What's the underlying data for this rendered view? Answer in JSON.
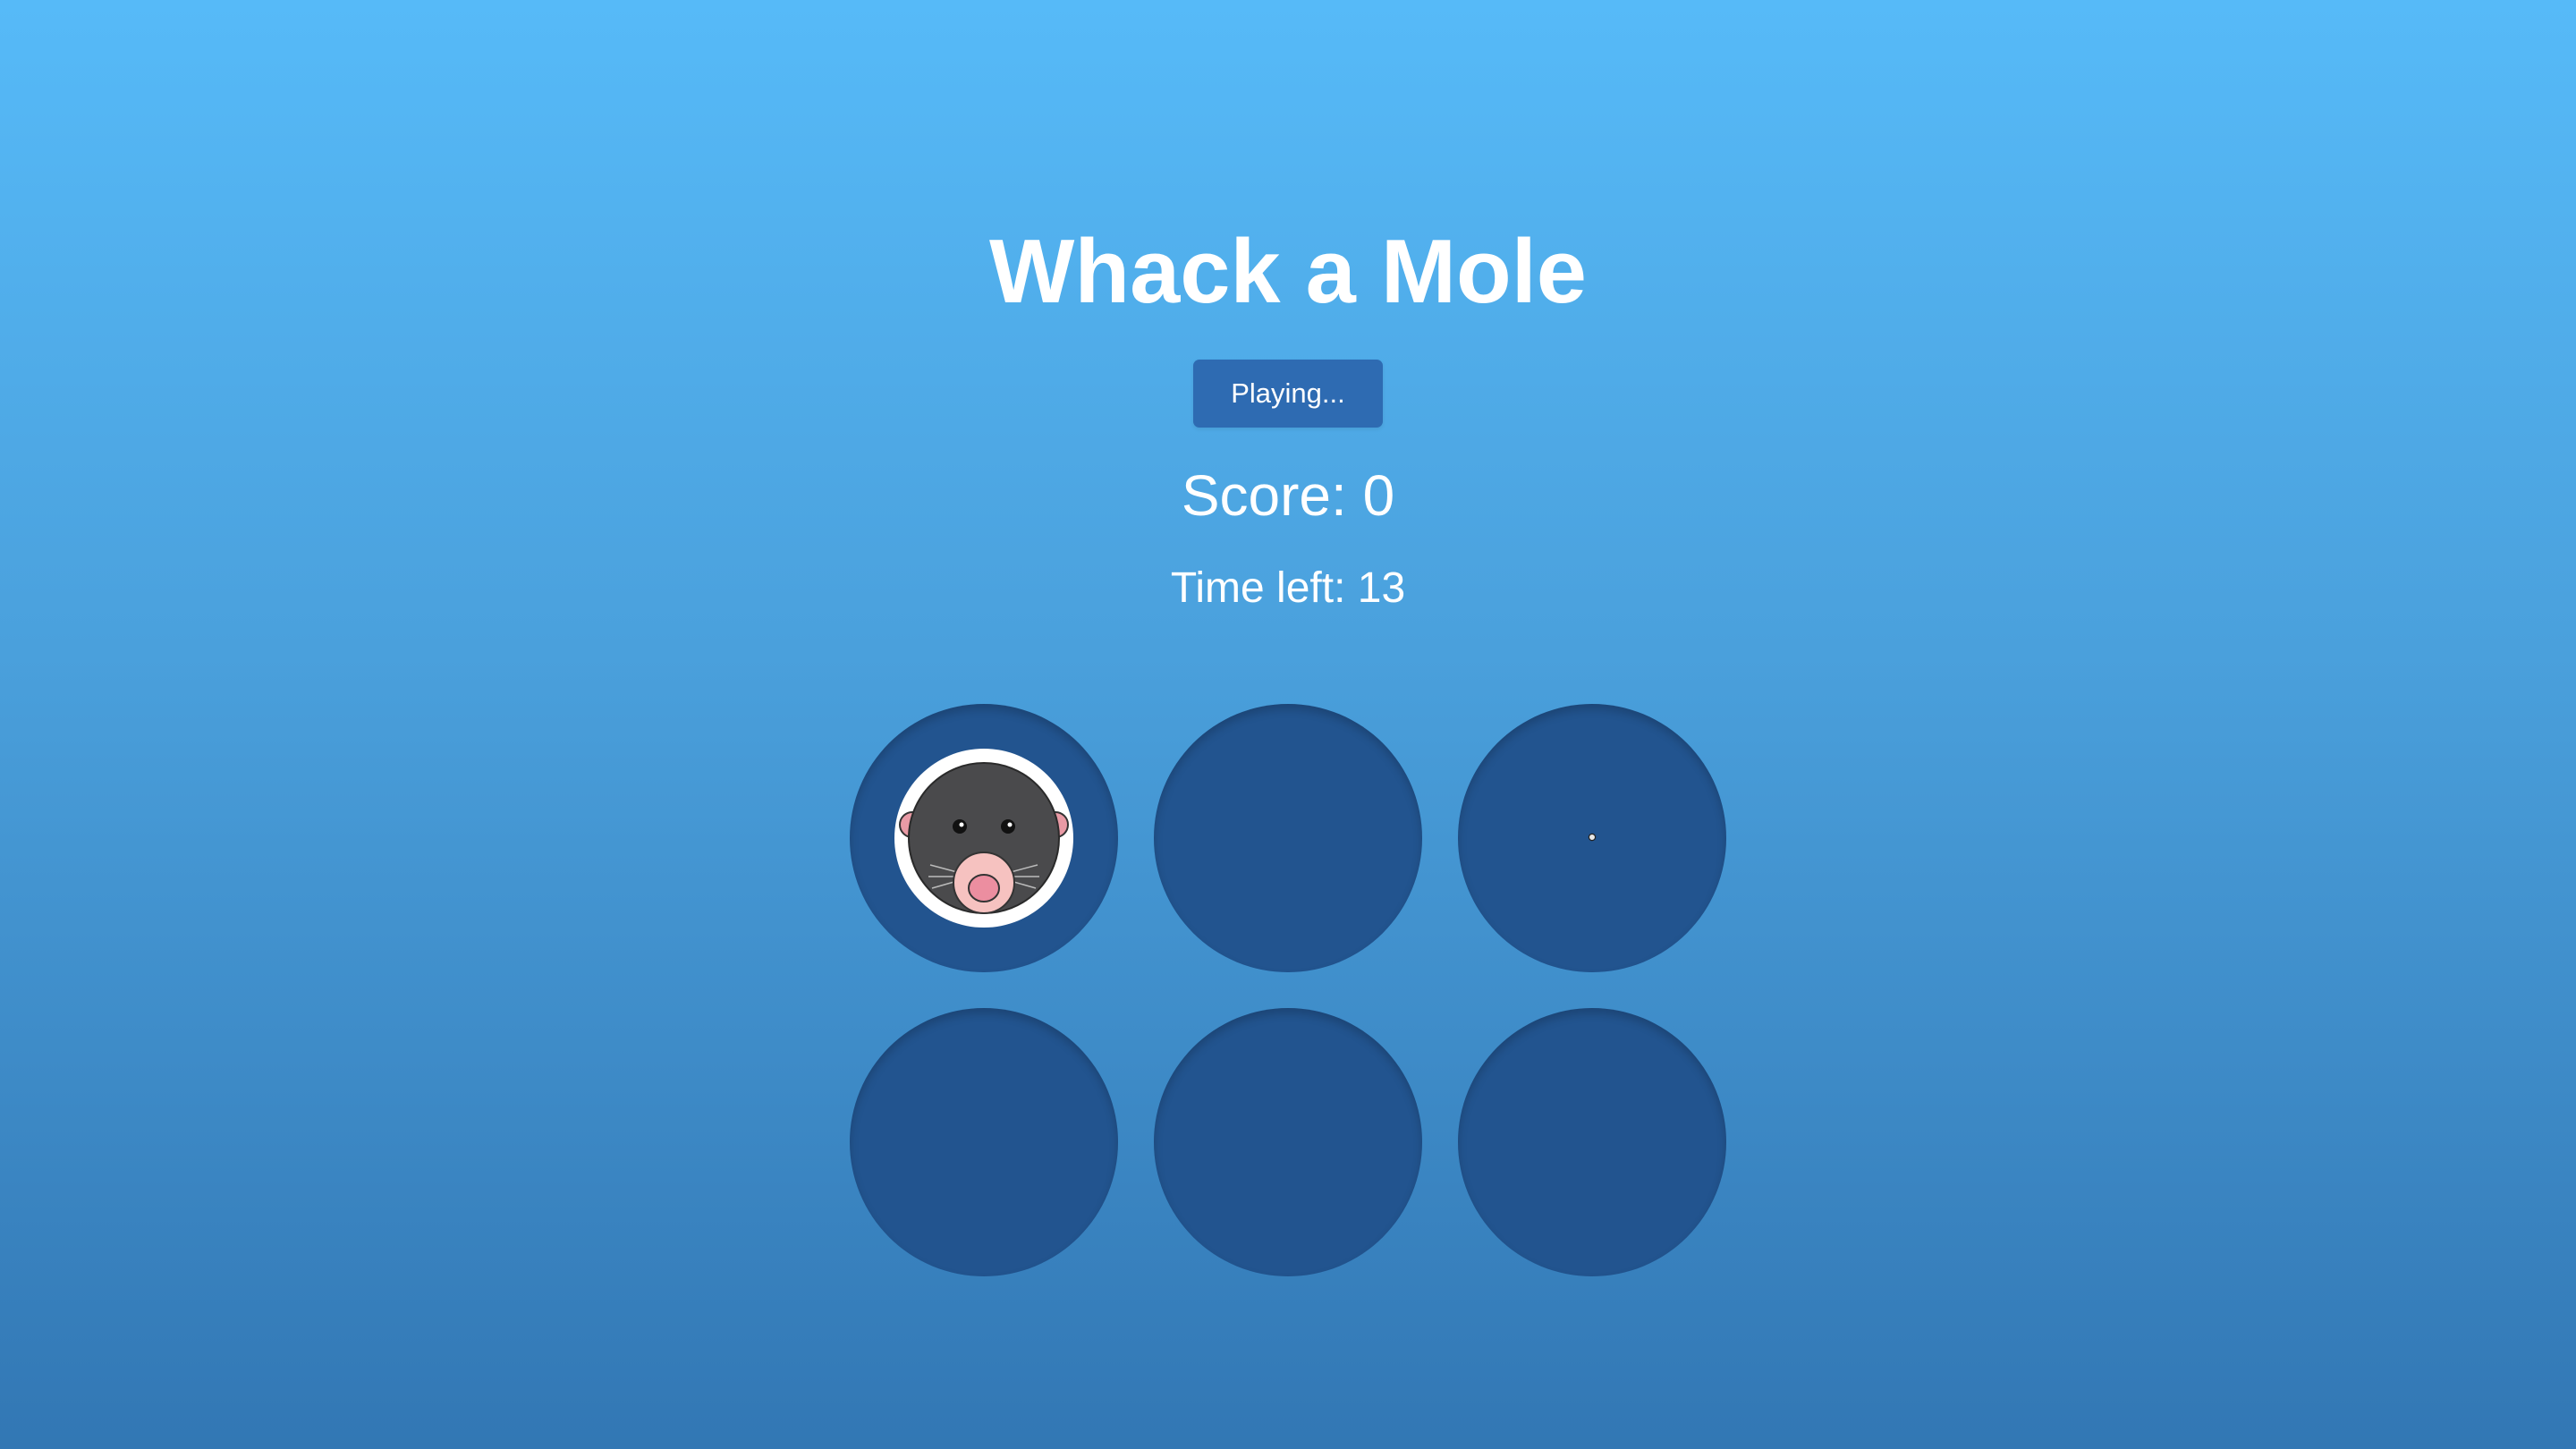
{
  "game": {
    "title": "Whack a Mole",
    "status_button_label": "Playing...",
    "score_label": "Score:",
    "score_value": "0",
    "time_label": "Time left:",
    "time_value": "13"
  },
  "board": {
    "rows": 2,
    "columns": 3,
    "holes": [
      {
        "has_mole": true
      },
      {
        "has_mole": false
      },
      {
        "has_mole": false,
        "has_cursor": true
      },
      {
        "has_mole": false
      },
      {
        "has_mole": false
      },
      {
        "has_mole": false
      }
    ]
  },
  "colors": {
    "background_top": "#56baf8",
    "background_bottom": "#3277b4",
    "button": "#2e6bb2",
    "hole": "#22548f",
    "mole_body": "#4a4a4c",
    "mole_nose": "#f2a6b0"
  },
  "icons": {
    "mole": "mole-icon",
    "cursor": "mouse-cursor-icon"
  }
}
